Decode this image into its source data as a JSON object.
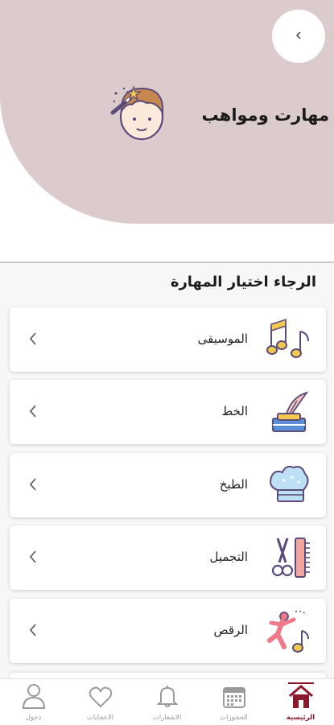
{
  "header": {
    "title": "مهارت ومواهب",
    "back_icon": "chevron-left-icon",
    "hero_icon": "magician-kid-icon"
  },
  "section": {
    "title": "الرجاء اختيار المهارة"
  },
  "skills": [
    {
      "label": "الموسيقى",
      "icon": "music-notes-icon"
    },
    {
      "label": "الخط",
      "icon": "ink-quill-icon"
    },
    {
      "label": "الطبخ",
      "icon": "chef-hat-icon"
    },
    {
      "label": "التجميل",
      "icon": "scissors-comb-icon"
    },
    {
      "label": "الرقص",
      "icon": "dancer-icon"
    }
  ],
  "nav": [
    {
      "label": "الرئيسية",
      "icon": "home-icon",
      "active": true
    },
    {
      "label": "الحجوزات",
      "icon": "calendar-icon",
      "active": false
    },
    {
      "label": "الاشعارات",
      "icon": "bell-icon",
      "active": false
    },
    {
      "label": "الاعجابات",
      "icon": "heart-icon",
      "active": false
    },
    {
      "label": "دخول",
      "icon": "user-icon",
      "active": false
    }
  ],
  "colors": {
    "hero_bg": "#dccbcd",
    "accent": "#8a1a2c",
    "icon_yellow": "#f2c94c",
    "icon_outline": "#5b4a7a"
  }
}
